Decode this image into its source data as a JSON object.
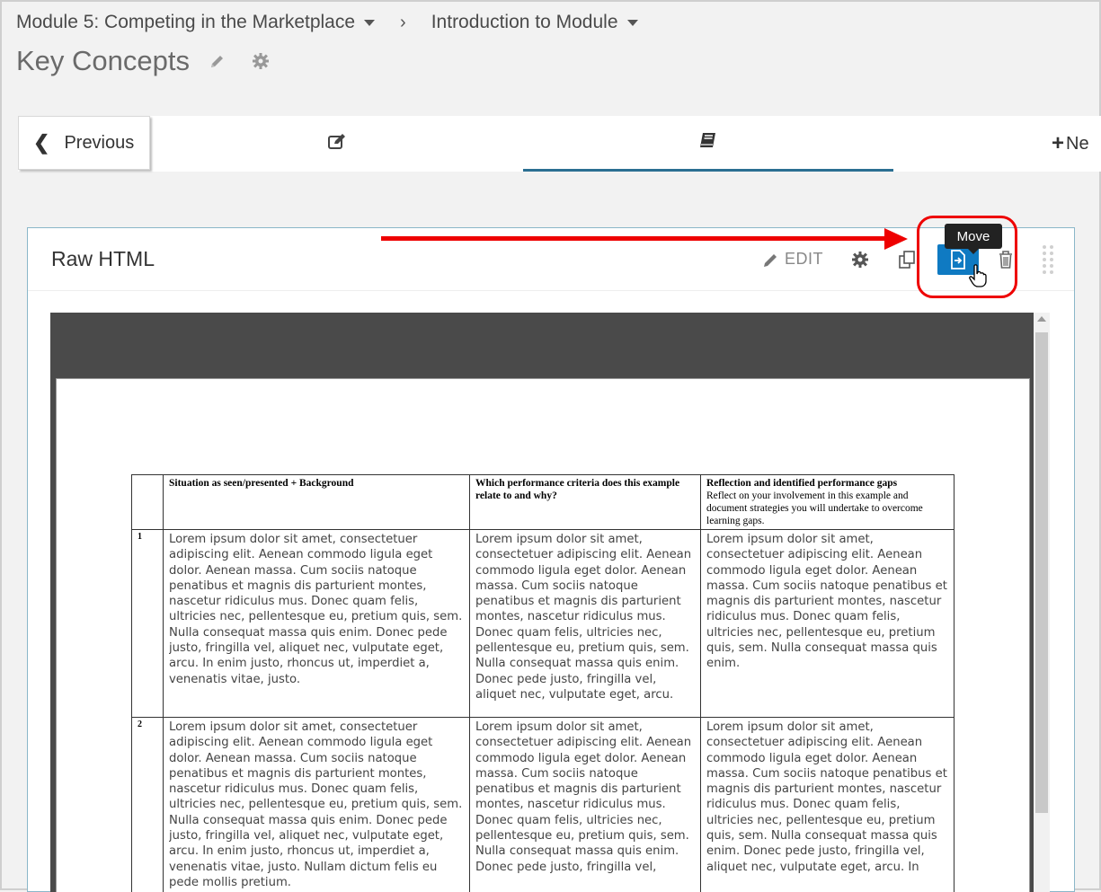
{
  "breadcrumb": {
    "module": "Module 5: Competing in the Marketplace",
    "separator": "›",
    "section": "Introduction to Module"
  },
  "page_title": "Key Concepts",
  "nav": {
    "previous_label": "Previous",
    "next_label": "Ne"
  },
  "component": {
    "title": "Raw HTML",
    "edit_label": "EDIT",
    "tooltip": "Move"
  },
  "document": {
    "headers": {
      "col1": "Situation as seen/presented + Background",
      "col2": "Which performance criteria does this example relate to and why?",
      "col3_title": "Reflection and identified performance gaps",
      "col3_sub": "Reflect on your involvement in this example and document strategies you will undertake to overcome learning gaps."
    },
    "rows": [
      {
        "num": "1",
        "c1": "Lorem ipsum dolor sit amet, consectetuer adipiscing elit. Aenean commodo ligula eget dolor. Aenean massa. Cum sociis natoque penatibus et magnis dis parturient montes, nascetur ridiculus mus. Donec quam felis, ultricies nec, pellentesque eu, pretium quis, sem. Nulla consequat massa quis enim. Donec pede justo, fringilla vel, aliquet nec, vulputate eget, arcu. In enim justo, rhoncus ut, imperdiet a, venenatis vitae, justo.",
        "c2": "Lorem ipsum dolor sit amet, consectetuer adipiscing elit. Aenean commodo ligula eget dolor. Aenean massa. Cum sociis natoque penatibus et magnis dis parturient montes, nascetur ridiculus mus. Donec quam felis, ultricies nec, pellentesque eu, pretium quis, sem. Nulla consequat massa quis enim. Donec pede justo, fringilla vel, aliquet nec, vulputate eget, arcu.",
        "c3": "Lorem ipsum dolor sit amet, consectetuer adipiscing elit. Aenean commodo ligula eget dolor. Aenean massa. Cum sociis natoque penatibus et magnis dis parturient montes, nascetur ridiculus mus. Donec quam felis, ultricies nec, pellentesque eu, pretium quis, sem. Nulla consequat massa quis enim."
      },
      {
        "num": "2",
        "c1": "Lorem ipsum dolor sit amet, consectetuer adipiscing elit. Aenean commodo ligula eget dolor. Aenean massa. Cum sociis natoque penatibus et magnis dis parturient montes, nascetur ridiculus mus. Donec quam felis, ultricies nec, pellentesque eu, pretium quis, sem. Nulla consequat massa quis enim. Donec pede justo, fringilla vel, aliquet nec, vulputate eget, arcu. In enim justo, rhoncus ut, imperdiet a, venenatis vitae, justo. Nullam dictum felis eu pede mollis pretium.",
        "c2": "Lorem ipsum dolor sit amet, consectetuer adipiscing elit. Aenean commodo ligula eget dolor. Aenean massa. Cum sociis natoque penatibus et magnis dis parturient montes, nascetur ridiculus mus. Donec quam felis, ultricies nec, pellentesque eu, pretium quis, sem. Nulla consequat massa quis enim. Donec pede justo, fringilla vel,",
        "c3": "Lorem ipsum dolor sit amet, consectetuer adipiscing elit. Aenean commodo ligula eget dolor. Aenean massa. Cum sociis natoque penatibus et magnis dis parturient montes, nascetur ridiculus mus. Donec quam felis, ultricies nec, pellentesque eu, pretium quis, sem. Nulla consequat massa quis enim. Donec pede justo, fringilla vel, aliquet nec, vulputate eget, arcu. In"
      }
    ]
  },
  "colors": {
    "accent": "#0f7ac2",
    "active_tab_underline": "#2b6f92",
    "annotation": "#e00000"
  },
  "icons": {
    "breadcrumb": [
      "chevron-down-icon",
      "chevron-right-icon"
    ],
    "title": [
      "pencil-icon",
      "gear-icon"
    ],
    "tabs": [
      "edit-icon",
      "book-icon",
      "plus-icon"
    ],
    "component_toolbar": [
      "pencil-icon",
      "gear-icon",
      "duplicate-icon",
      "move-icon",
      "trash-icon",
      "drag-handle-icon"
    ]
  }
}
